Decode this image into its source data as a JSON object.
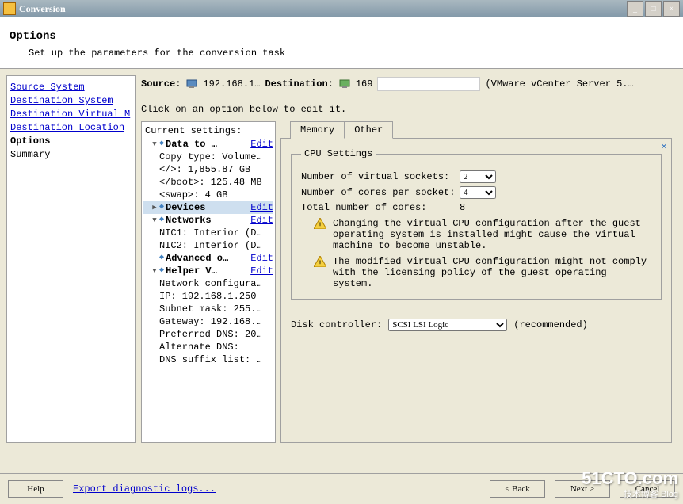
{
  "window": {
    "title": "Conversion",
    "min": "_",
    "max": "□",
    "close": "×"
  },
  "header": {
    "title": "Options",
    "subtitle": "Set up the parameters for the conversion task"
  },
  "nav": {
    "items": [
      {
        "label": "Source System",
        "kind": "link"
      },
      {
        "label": "Destination System",
        "kind": "link"
      },
      {
        "label": "Destination Virtual M",
        "kind": "link"
      },
      {
        "label": "Destination Location",
        "kind": "link"
      },
      {
        "label": "Options",
        "kind": "bold"
      },
      {
        "label": "Summary",
        "kind": "plain"
      }
    ]
  },
  "srcdest": {
    "source_label": "Source:",
    "source_value": "192.168.1…",
    "dest_label": "Destination:",
    "dest_value": "169",
    "dest_host_suffix": "(VMware vCenter Server 5.…"
  },
  "instruction": "Click on an option below to edit it.",
  "tree": {
    "title": "Current settings:",
    "edit_label": "Edit",
    "nodes": [
      {
        "caret": "▼",
        "bullet": true,
        "label": "Data to …",
        "edit": true,
        "bold": true,
        "indent": 1
      },
      {
        "label": "Copy type: Volume…",
        "indent": 2
      },
      {
        "label": "</>: 1,855.87 GB",
        "indent": 2
      },
      {
        "label": "</boot>: 125.48 MB",
        "indent": 2
      },
      {
        "label": "<swap>: 4 GB",
        "indent": 2
      },
      {
        "caret": "▶",
        "bullet": true,
        "label": "Devices",
        "edit": true,
        "bold": true,
        "selected": true,
        "indent": 1
      },
      {
        "caret": "▼",
        "bullet": true,
        "label": "Networks",
        "edit": true,
        "bold": true,
        "indent": 1
      },
      {
        "label": "NIC1: Interior (D…",
        "indent": 2
      },
      {
        "label": "NIC2: Interior (D…",
        "indent": 2
      },
      {
        "caret": "",
        "bullet": true,
        "label": "Advanced o…",
        "edit": true,
        "bold": true,
        "indent": 1
      },
      {
        "caret": "▼",
        "bullet": true,
        "label": "Helper V…",
        "edit": true,
        "bold": true,
        "indent": 1
      },
      {
        "label": "Network configura…",
        "indent": 2
      },
      {
        "label": "IP: 192.168.1.250",
        "indent": 2
      },
      {
        "label": "Subnet mask: 255.…",
        "indent": 2
      },
      {
        "label": "Gateway: 192.168.…",
        "indent": 2
      },
      {
        "label": "Preferred DNS: 20…",
        "indent": 2
      },
      {
        "label": "Alternate DNS:",
        "indent": 2
      },
      {
        "label": "DNS suffix list: …",
        "indent": 2
      }
    ]
  },
  "tabs": {
    "memory": "Memory",
    "other": "Other"
  },
  "cpu": {
    "legend": "CPU Settings",
    "sockets_label": "Number of virtual sockets:",
    "sockets_value": "2",
    "cores_label": "Number of cores per socket:",
    "cores_value": "4",
    "total_label": "Total number of cores:",
    "total_value": "8",
    "warn1": "Changing the virtual CPU configuration after the guest operating system is installed might cause the virtual machine to become unstable.",
    "warn2": "The modified virtual CPU configuration might not comply with the licensing policy of the guest operating system."
  },
  "disk": {
    "label": "Disk controller:",
    "value": "SCSI LSI Logic",
    "hint": "(recommended)"
  },
  "footer": {
    "help": "Help",
    "export": "Export diagnostic logs...",
    "back": "< Back",
    "next": "Next >",
    "cancel": "Cancel"
  },
  "watermark": {
    "main": "51CTO.com",
    "sub": "技术博客 Blog"
  }
}
